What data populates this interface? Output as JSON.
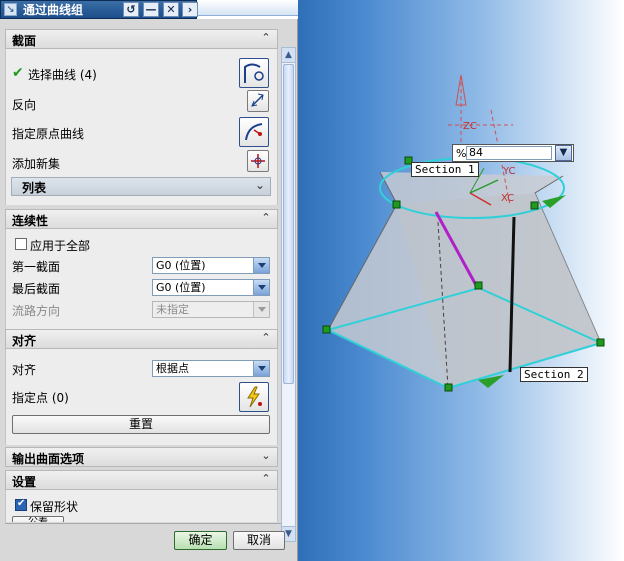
{
  "titlebar": {
    "title": "通过曲线组",
    "grip_icon": "drag-handle-icon",
    "buttons": [
      "reset-icon",
      "minimize-icon",
      "close-icon",
      "expand-icon"
    ]
  },
  "sections": {
    "section": {
      "title": "截面",
      "select_curve": "选择曲线 (4)",
      "reverse": "反向",
      "origin_curve": "指定原点曲线",
      "add_set": "添加新集",
      "list": "列表"
    },
    "continuity": {
      "title": "连续性",
      "apply_all": "应用于全部",
      "apply_all_checked": false,
      "first_section": "第一截面",
      "first_value": "G0 (位置)",
      "last_section": "最后截面",
      "last_value": "G0 (位置)",
      "flow_dir": "流路方向",
      "flow_value": "未指定"
    },
    "alignment": {
      "title": "对齐",
      "align": "对齐",
      "align_value": "根据点",
      "points": "指定点 (0)",
      "reset": "重置"
    },
    "output": {
      "title": "输出曲面选项"
    },
    "settings": {
      "title": "设置",
      "keep_shape": "保留形状",
      "keep_shape_checked": true,
      "partial": "公差"
    }
  },
  "footer": {
    "ok": "确定",
    "cancel": "取消"
  },
  "viewport": {
    "section1_label": "Section 1",
    "section2_label": "Section 2",
    "percent_label": "%",
    "percent_value": "84",
    "axis_zc": "ZC",
    "axis_yc": "YC",
    "axis_xc": "XC"
  },
  "colors": {
    "accent": "#2c64b4",
    "ok_green": "#2f6a2f",
    "section_cyan": "#30d0d8",
    "magenta_path": "#b020c8"
  }
}
